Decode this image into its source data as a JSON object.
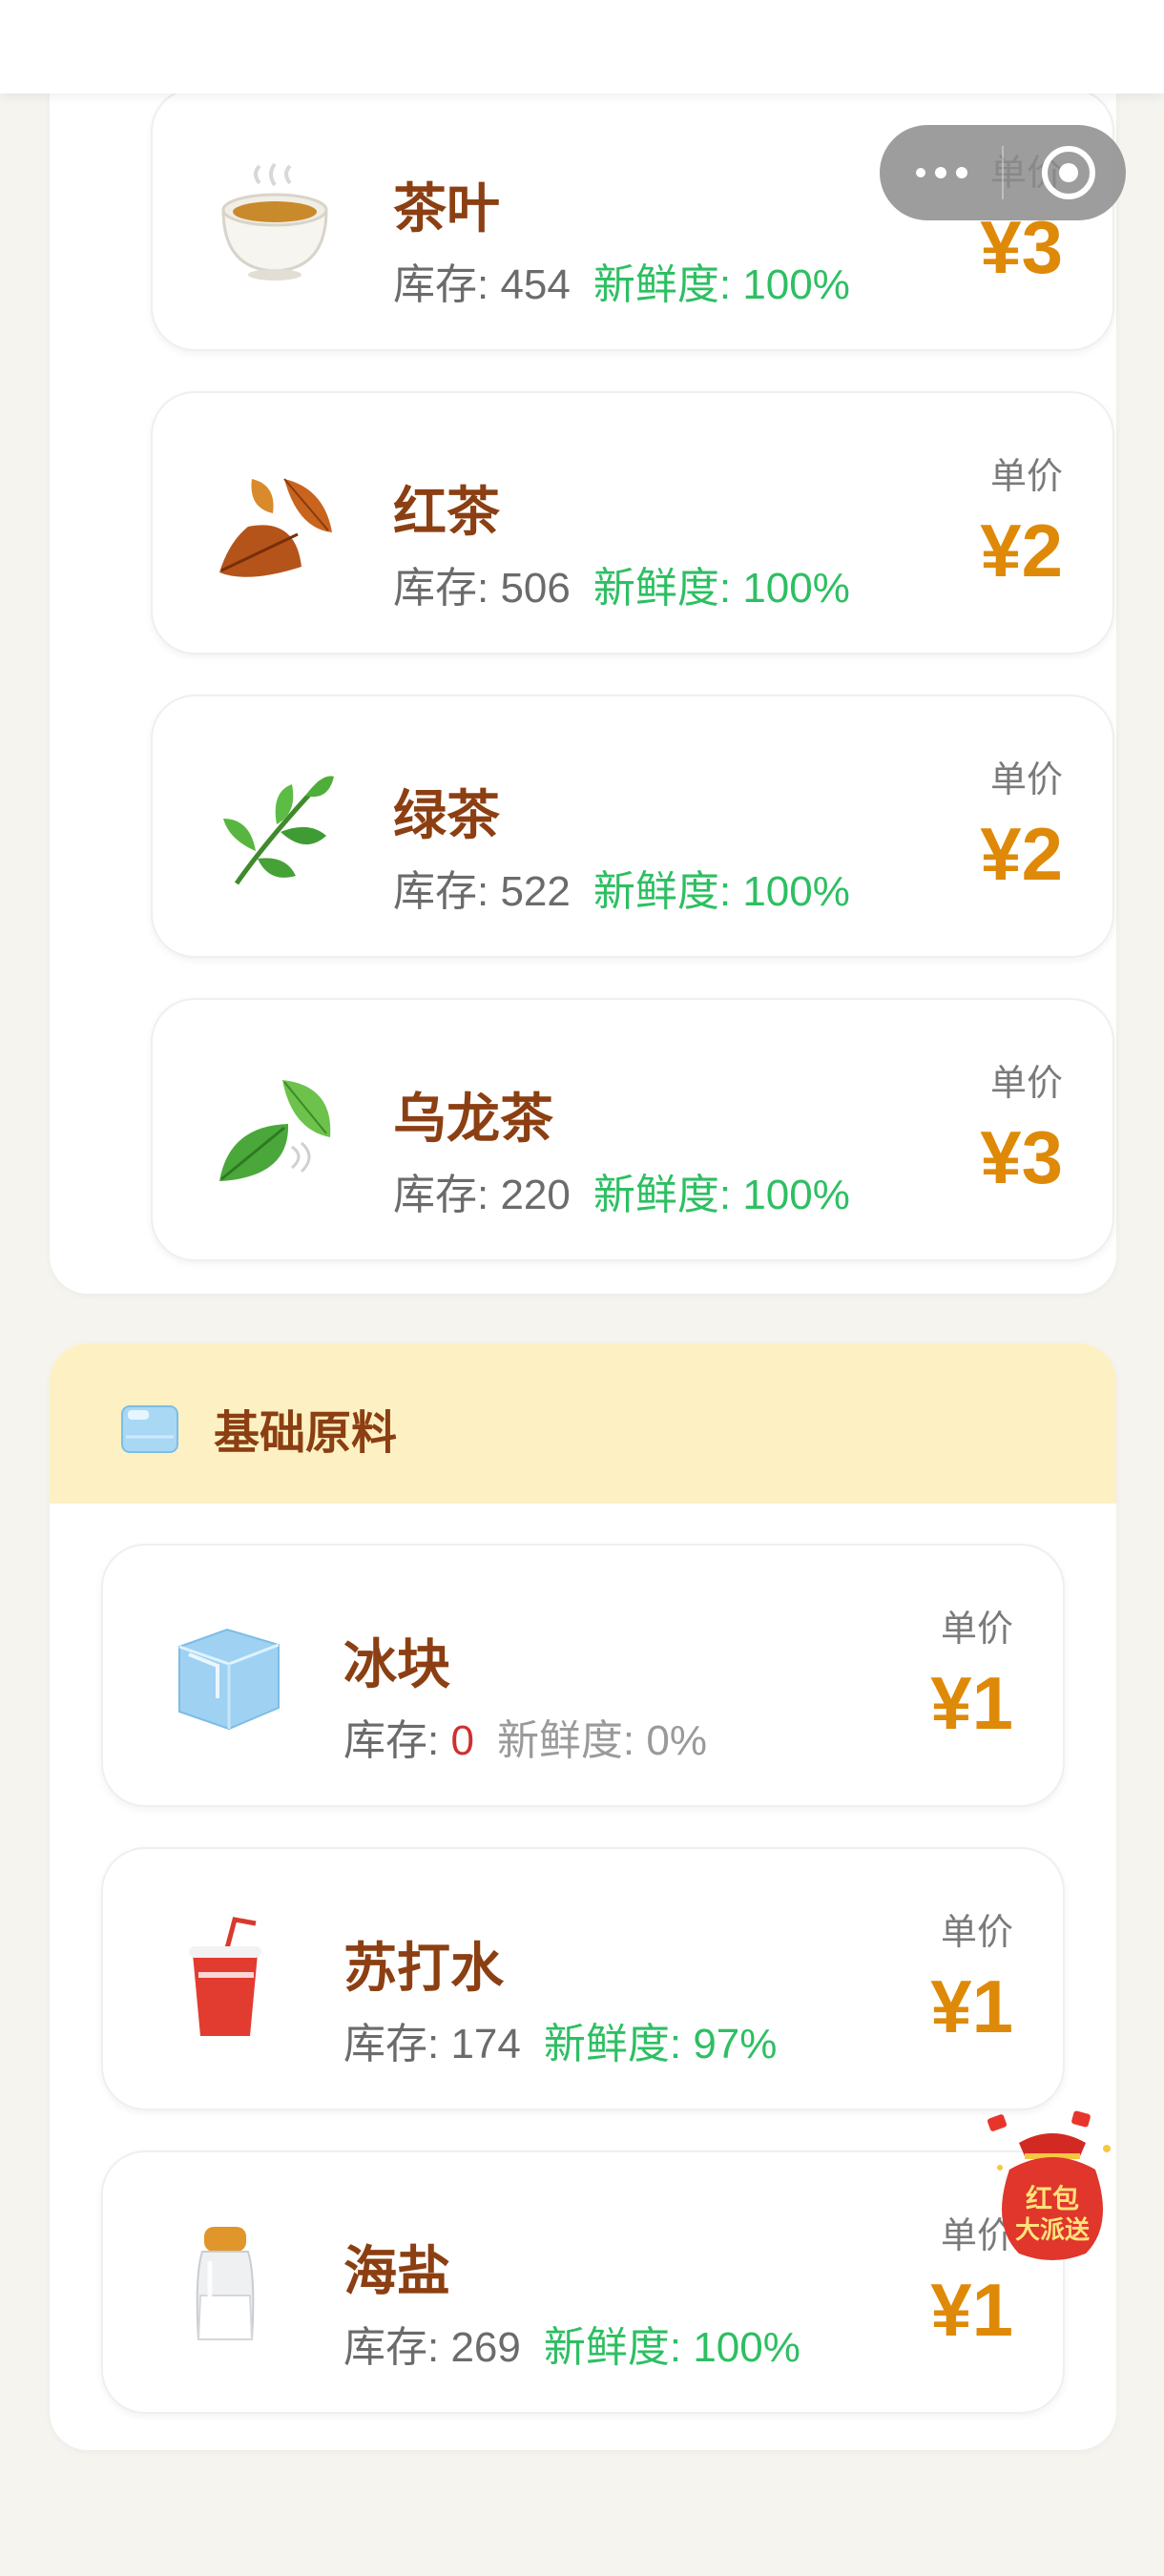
{
  "capsule": {
    "menu_icon": "more-dots-icon",
    "close_icon": "target-icon"
  },
  "tea_items": [
    {
      "name": "茶叶",
      "stock_label": "库存: ",
      "stock": "454",
      "fresh_label": "新鲜度: ",
      "freshness": "100%",
      "price_label": "单价",
      "price": "¥3",
      "icon": "tea-cup-icon"
    },
    {
      "name": "红茶",
      "stock_label": "库存: ",
      "stock": "506",
      "fresh_label": "新鲜度: ",
      "freshness": "100%",
      "price_label": "单价",
      "price": "¥2",
      "icon": "fallen-leaves-icon"
    },
    {
      "name": "绿茶",
      "stock_label": "库存: ",
      "stock": "522",
      "fresh_label": "新鲜度: ",
      "freshness": "100%",
      "price_label": "单价",
      "price": "¥2",
      "icon": "herb-icon"
    },
    {
      "name": "乌龙茶",
      "stock_label": "库存: ",
      "stock": "220",
      "fresh_label": "新鲜度: ",
      "freshness": "100%",
      "price_label": "单价",
      "price": "¥3",
      "icon": "leaf-wind-icon"
    }
  ],
  "base_section": {
    "title": "基础原料",
    "icon": "ice-cube-icon",
    "items": [
      {
        "name": "冰块",
        "stock_label": "库存: ",
        "stock": "0",
        "fresh_label": "新鲜度: ",
        "freshness": "0%",
        "price_label": "单价",
        "price": "¥1",
        "icon": "ice-cube-icon"
      },
      {
        "name": "苏打水",
        "stock_label": "库存: ",
        "stock": "174",
        "fresh_label": "新鲜度: ",
        "freshness": "97%",
        "price_label": "单价",
        "price": "¥1",
        "icon": "soda-cup-icon"
      },
      {
        "name": "海盐",
        "stock_label": "库存: ",
        "stock": "269",
        "fresh_label": "新鲜度: ",
        "freshness": "100%",
        "price_label": "单价",
        "price": "¥1",
        "icon": "salt-shaker-icon"
      }
    ]
  },
  "floating_badge": {
    "line1": "红包",
    "line2": "大派送",
    "icon": "red-envelope-bag-icon"
  },
  "colors": {
    "accent_price": "#de8a08",
    "name": "#8b3f12",
    "fresh": "#2dbf62",
    "zero_stock": "#d03030",
    "header_bg": "#fdf1c3"
  }
}
